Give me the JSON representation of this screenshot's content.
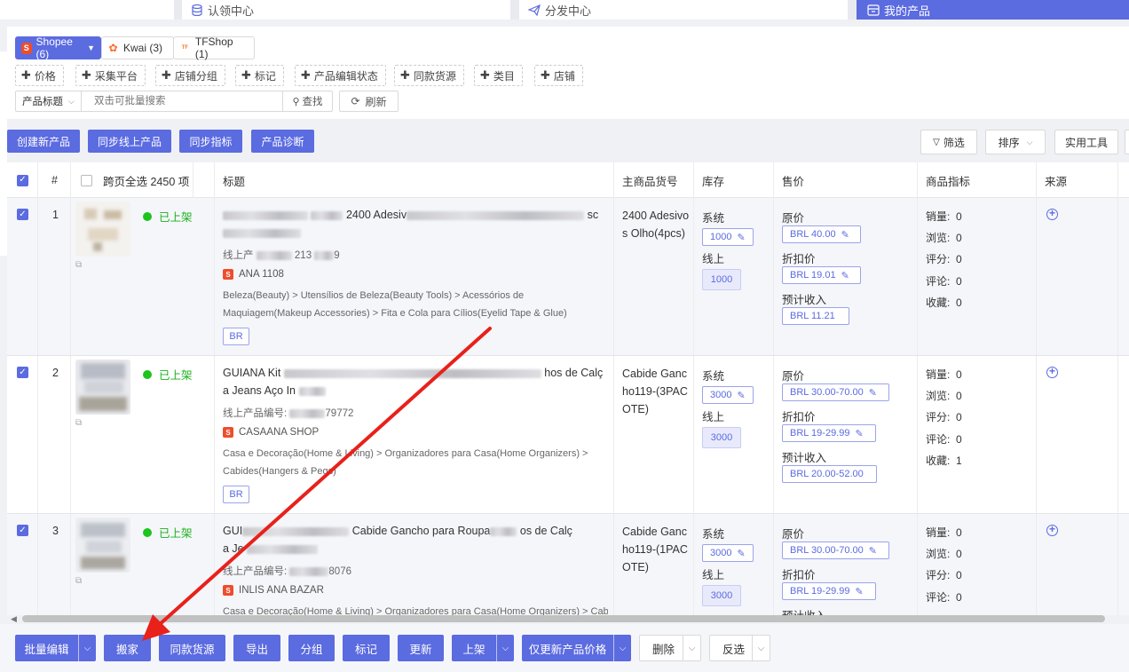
{
  "tabs": [
    {
      "label": "认领中心",
      "icon": "database-icon"
    },
    {
      "label": "分发中心",
      "icon": "send-icon"
    },
    {
      "label": "我的产品",
      "icon": "box-icon",
      "active": true
    }
  ],
  "shops": [
    {
      "label": "Shopee (6)",
      "icon": "shopee-icon",
      "selected": true
    },
    {
      "label": "Kwai (3)",
      "icon": "kwai-icon"
    },
    {
      "label": "TFShop (1)",
      "icon": "tfshop-icon"
    }
  ],
  "filters": [
    "价格",
    "采集平台",
    "店铺分组",
    "标记",
    "产品编辑状态",
    "同款货源",
    "类目",
    "店铺"
  ],
  "search": {
    "field_select": "产品标题",
    "placeholder": "双击可批量搜索",
    "search_button": "查找",
    "refresh_button": "刷新"
  },
  "actions": {
    "create": "创建新产品",
    "sync_online": "同步线上产品",
    "sync_metrics": "同步指标",
    "diagnose": "产品诊断",
    "filter": "筛选",
    "sort": "排序",
    "tools": "实用工具"
  },
  "table": {
    "headers": {
      "index": "#",
      "select_all": "跨页全选 2450 项",
      "title": "标题",
      "sku": "主商品货号",
      "stock": "库存",
      "price": "售价",
      "metrics": "商品指标",
      "source": "来源"
    },
    "labels": {
      "system": "系统",
      "online": "线上",
      "original_price": "原价",
      "discount_price": "折扣价",
      "estimated_income": "预计收入",
      "sales": "销量:",
      "views": "浏览:",
      "rating": "评分:",
      "reviews": "评论:",
      "favorites": "收藏:"
    },
    "rows": [
      {
        "index": "1",
        "status": "已上架",
        "title_tail": "2400 Adesiv",
        "title_tail2": "sc",
        "online_id_label": "线上产",
        "online_id_tail": "213",
        "online_id_end": "9",
        "shop": "ANA 1108",
        "category": "Beleza(Beauty) > Utensílios de Beleza(Beauty Tools) > Acessórios de Maquiagem(Makeup Accessories) > Fita e Cola para Cílios(Eyelid Tape & Glue)",
        "region": "BR",
        "sku": "2400 Adesivos Olho(4pcs)",
        "stock_system": "1000",
        "stock_online": "1000",
        "price_original": "BRL  40.00",
        "price_discount": "BRL  19.01",
        "price_income": "BRL  11.21",
        "sales": "0",
        "views": "0",
        "rating": "0",
        "reviews": "0",
        "favorites": "0"
      },
      {
        "index": "2",
        "status": "已上架",
        "title_head": "GUIANA Kit",
        "title_tail": "hos de Calç",
        "title_line2": "a Jeans Aço In",
        "online_id_label": "线上产品编号:",
        "online_id_tail": "79772",
        "shop": "CASAANA SHOP",
        "category": "Casa e Decoração(Home & Living) > Organizadores para Casa(Home Organizers) > Cabides(Hangers & Pegs)",
        "region": "BR",
        "sku": "Cabide Gancho119-(3PACOTE)",
        "stock_system": "3000",
        "stock_online": "3000",
        "price_original": "BRL  30.00-70.00",
        "price_discount": "BRL  19-29.99",
        "price_income": "BRL  20.00-52.00",
        "sales": "0",
        "views": "0",
        "rating": "0",
        "reviews": "0",
        "favorites": "1"
      },
      {
        "index": "3",
        "status": "已上架",
        "title_head": "GUI",
        "title_mid": "Cabide Gancho para Roupa",
        "title_tail": "os de Calç",
        "title_line2": "a Je",
        "online_id_label": "线上产品编号:",
        "online_id_tail": "8076",
        "shop": "INLIS ANA BAZAR",
        "category": "Casa e Decoração(Home & Living) > Organizadores para Casa(Home Organizers) > Cabi",
        "sku": "Cabide Gancho119-(1PACOTE)",
        "stock_system": "3000",
        "stock_online": "3000",
        "price_original": "BRL  30.00-70.00",
        "price_discount": "BRL  19-29.99",
        "price_income": "预计收入",
        "sales": "0",
        "views": "0",
        "rating": "0",
        "reviews": "0"
      }
    ]
  },
  "bottom": {
    "batch_edit": "批量编辑",
    "move": "搬家",
    "same_source": "同款货源",
    "export": "导出",
    "group": "分组",
    "mark": "标记",
    "update": "更新",
    "publish": "上架",
    "update_price": "仅更新产品价格",
    "delete": "删除",
    "invert": "反选"
  },
  "colors": {
    "accent": "#5b6be0",
    "status_green": "#1cc41c",
    "shopee": "#ee4d2d",
    "annotation_arrow": "#e8211b"
  }
}
